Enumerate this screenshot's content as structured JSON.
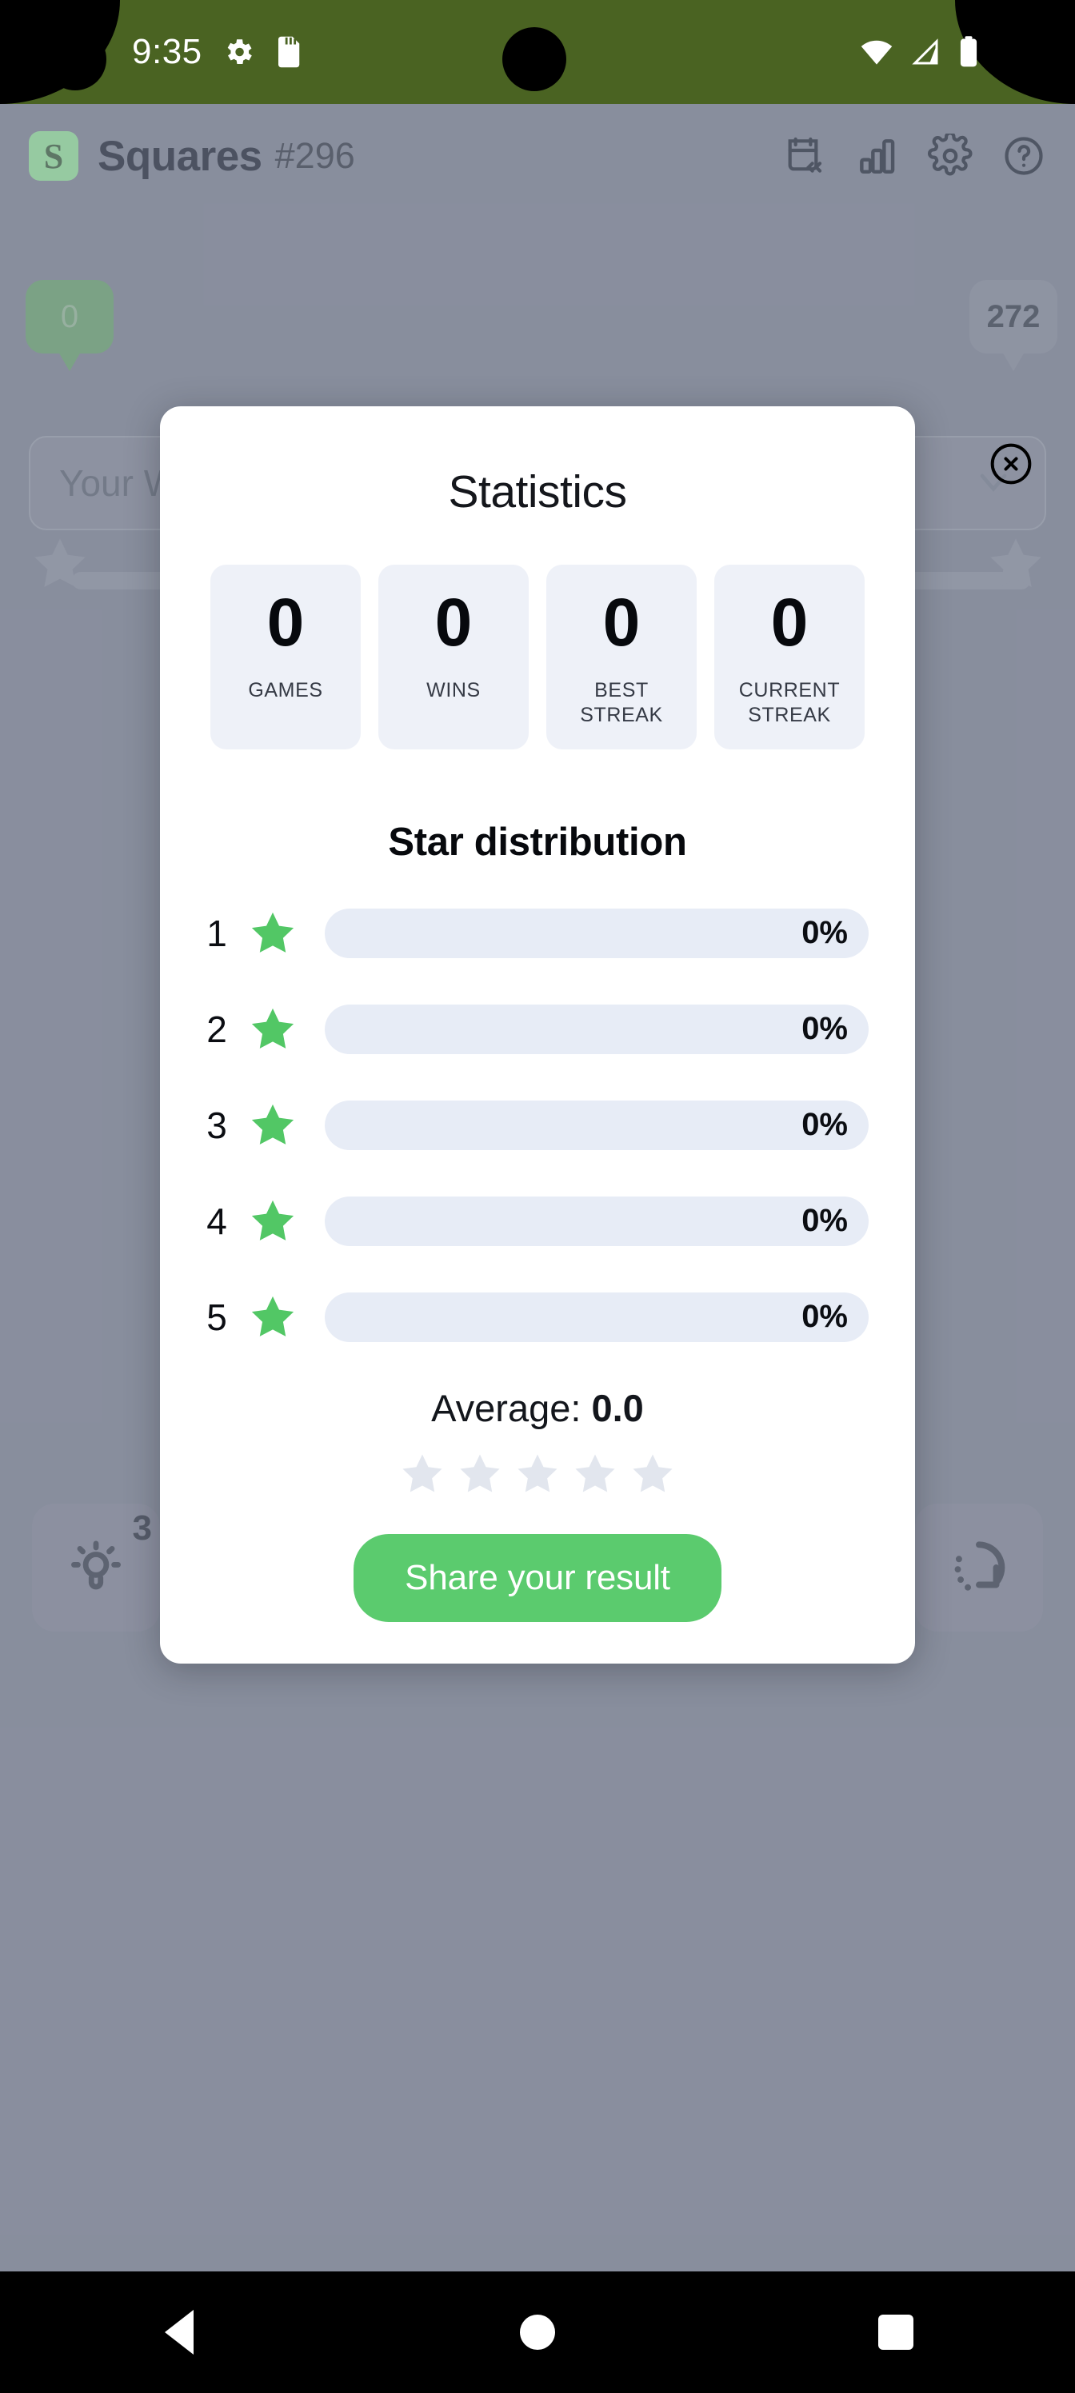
{
  "status_bar": {
    "time": "9:35",
    "icons": [
      "gear-icon",
      "sd-card-icon",
      "wifi-icon",
      "cellular-signal-icon",
      "battery-icon"
    ],
    "background_color": "#4a6322"
  },
  "app_header": {
    "logo_letter": "S",
    "title": "Squares",
    "puzzle_number": "#296",
    "icons": [
      "calendar-archive-icon",
      "bar-chart-icon",
      "gear-icon",
      "help-circle-icon"
    ]
  },
  "progress": {
    "current_badge": "0",
    "target_badge": "272",
    "milestone_count": 5
  },
  "word_row": {
    "label": "Your W",
    "chevron": "chevron-down-icon"
  },
  "background_controls": {
    "hint_label": "hint-bulb-icon",
    "hint_count": "3",
    "retry_label": "retry-icon"
  },
  "modal": {
    "title": "Statistics",
    "close_icon": "close-circle-icon",
    "stats": [
      {
        "value": "0",
        "label": "GAMES"
      },
      {
        "value": "0",
        "label": "WINS"
      },
      {
        "value": "0",
        "label": "BEST\nSTREAK"
      },
      {
        "value": "0",
        "label": "CURRENT\nSTREAK"
      }
    ],
    "distribution_title": "Star distribution",
    "average_prefix": "Average: ",
    "average_value": "0.0",
    "average_star_count": 5,
    "share_label": "Share your result",
    "accent_color": "#5bcb6e",
    "bar_track_color": "#e7ecf6"
  },
  "chart_data": {
    "type": "bar",
    "title": "Star distribution",
    "orientation": "horizontal",
    "categories": [
      "1",
      "2",
      "3",
      "4",
      "5"
    ],
    "values": [
      0,
      0,
      0,
      0,
      0
    ],
    "value_labels": [
      "0%",
      "0%",
      "0%",
      "0%",
      "0%"
    ],
    "xlabel": "",
    "ylabel": "Stars",
    "xlim": [
      0,
      100
    ],
    "grid": false,
    "legend": "none",
    "series_color": "#5bcb6e",
    "average": 0.0
  },
  "nav_bar": {
    "buttons": [
      "back-button",
      "home-button",
      "recents-button"
    ]
  }
}
